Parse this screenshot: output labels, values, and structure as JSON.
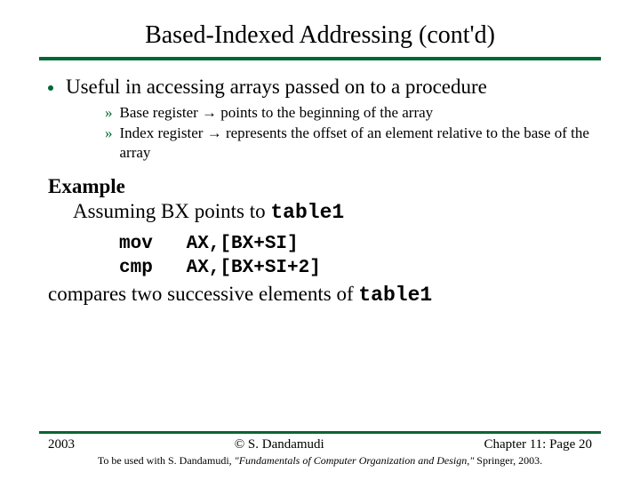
{
  "title": "Based-Indexed Addressing (cont'd)",
  "bullet": "Useful in accessing arrays passed on to a procedure",
  "sub": {
    "a_pre": "Base register ",
    "a_post": " points to the beginning of the array",
    "b_pre": "Index register ",
    "b_post": " represents the offset of an element relative to the base of the array",
    "arrow": "→"
  },
  "example": {
    "head": "Example",
    "assume_pre": "Assuming BX points to ",
    "assume_code": "table1",
    "code1": "mov   AX,[BX+SI]",
    "code2": "cmp   AX,[BX+SI+2]",
    "after_pre": "compares two successive elements of ",
    "after_code": "table1"
  },
  "footer": {
    "year": "2003",
    "center": "© S. Dandamudi",
    "right": "Chapter 11: Page 20",
    "cite_pre": "To be used with S. Dandamudi, ",
    "cite_it": "\"Fundamentals of Computer Organization and Design,\"",
    "cite_post": " Springer, 2003."
  }
}
